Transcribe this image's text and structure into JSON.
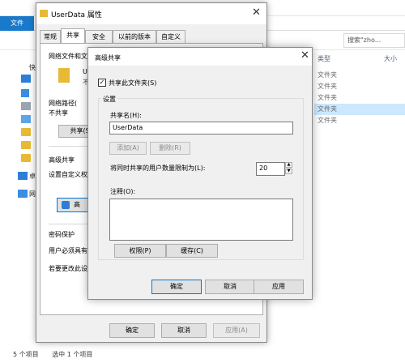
{
  "explorer": {
    "ribbon_file": "文件",
    "search_placeholder": "搜索\"zho...",
    "columns": {
      "type": "类型",
      "size": "大小"
    },
    "type_rows": [
      "文件夹",
      "文件夹",
      "文件夹",
      "文件夹",
      "文件夹"
    ],
    "selected_row": 3,
    "status": {
      "items": "5 个项目",
      "selected": "选中 1 个项目"
    },
    "nav_partial": [
      "快",
      "U",
      "卓",
      "网"
    ]
  },
  "props": {
    "title": "UserData 属性",
    "tabs": [
      "常规",
      "共享",
      "安全",
      "以前的版本",
      "自定义"
    ],
    "active_tab": 1,
    "section_network": "网络文件和文",
    "folder_name_partial": "Us",
    "folder_sub_partial": "不",
    "network_path_label": "网络路径(",
    "not_shared": "不共享",
    "share_button": "共享(S)...",
    "advanced_section": "高级共享",
    "advanced_desc": "设置自定义权",
    "advanced_button_partial": "高",
    "password_section": "密码保护",
    "password_line1": "用户必须具有",
    "password_line2": "若要更改此设",
    "ok": "确定",
    "cancel": "取消",
    "apply": "应用(A)"
  },
  "advanced": {
    "title": "高级共享",
    "share_checkbox": "共享此文件夹(S)",
    "share_checked": true,
    "settings_group": "设置",
    "share_name_label": "共享名(H):",
    "share_name_value": "UserData",
    "add_button": "添加(A)",
    "remove_button": "删除(R)",
    "limit_label": "将同时共享的用户数量限制为(L):",
    "limit_value": "20",
    "comment_label": "注释(O):",
    "comment_value": "",
    "permissions_button": "权限(P)",
    "caching_button": "缓存(C)",
    "ok": "确定",
    "cancel": "取消",
    "apply": "应用"
  },
  "colors": {
    "accent": "#0078d7",
    "ribbon_file_bg": "#1979ca",
    "selection": "#cce8ff",
    "folder": "#e8b935"
  }
}
